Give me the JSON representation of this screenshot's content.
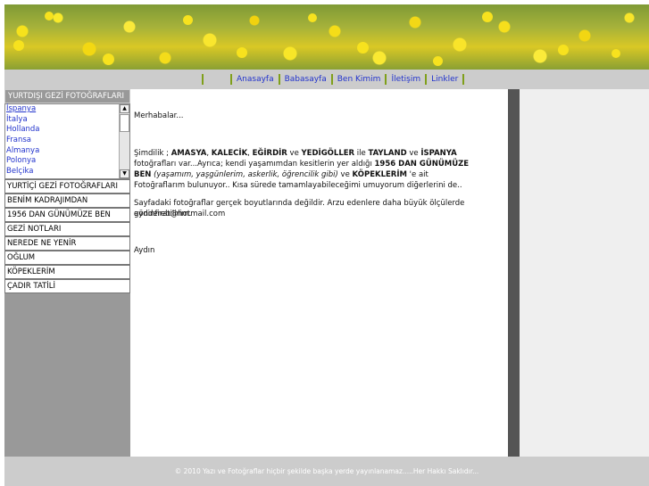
{
  "nav": {
    "items": [
      "Anasayfa",
      "Babasayfa",
      "Ben Kimim",
      "İletişim",
      "Linkler"
    ]
  },
  "sidebar": {
    "title": "YURTDIŞI GEZİ FOTOĞRAFLARI",
    "countries": [
      "İspanya",
      "İtalya",
      "Hollanda",
      "Fransa",
      "Almanya",
      "Polonya",
      "Belçika"
    ],
    "selected_country": "İspanya",
    "menu": [
      "YURTİÇİ GEZİ FOTOĞRAFLARI",
      "BENİM KADRAJIMDAN",
      "1956 DAN GÜNÜMÜZE BEN",
      "GEZİ NOTLARI",
      "NEREDE NE YENİR",
      "OĞLUM",
      "KÖPEKLERİM",
      "ÇADIR TATİLİ"
    ]
  },
  "content": {
    "greeting": "Merhabalar...",
    "p1_start": "Şimdilik ; ",
    "p1_b1": "AMASYA",
    "p1_c1": ", ",
    "p1_b2": "KALECİK",
    "p1_c2": ", ",
    "p1_b3": "EĞİRDİR",
    "p1_c3": " ve ",
    "p1_b4": "YEDİGÖLLER",
    "p1_c4": "  ile ",
    "p1_b5": "TAYLAND",
    "p1_c5": " ve ",
    "p1_b6": "İSPANYA",
    "p1_c6": " fotoğrafları var...Ayrıca; kendi yaşamımdan kesitlerin yer aldığı ",
    "p1_b7": "1956 DAN GÜNÜMÜZE BEN",
    "p1_c7": " ",
    "p1_i1": "(yaşamım, yaşgünlerim, askerlik, öğrencilik gibi)",
    "p1_c8": " ve ",
    "p1_b8": "KÖPEKLERİM",
    "p1_c9": " 'e ait Fotoğraflarım bulunuyor.. Kısa sürede tamamlayabileceğimi umuyorum diğerlerini de..",
    "p2": "Sayfadaki fotoğraflar gerçek boyutlarında değildir. Arzu edenlere daha büyük ölçülerde gönderebilirim.",
    "email": "aydinfirat@hotmail.com",
    "signature": "Aydın"
  },
  "footer": {
    "text": "© 2010  Yazı ve Fotoğraflar hiçbir şekilde başka yerde yayınlanamaz.....Her Hakkı Saklıdır..."
  },
  "colors": {
    "nav_link": "#2233cc",
    "nav_separator": "#7f9f1a",
    "sidebar_bg": "#999999",
    "footer_bg": "#cccccc",
    "dark_bar": "#555555"
  }
}
